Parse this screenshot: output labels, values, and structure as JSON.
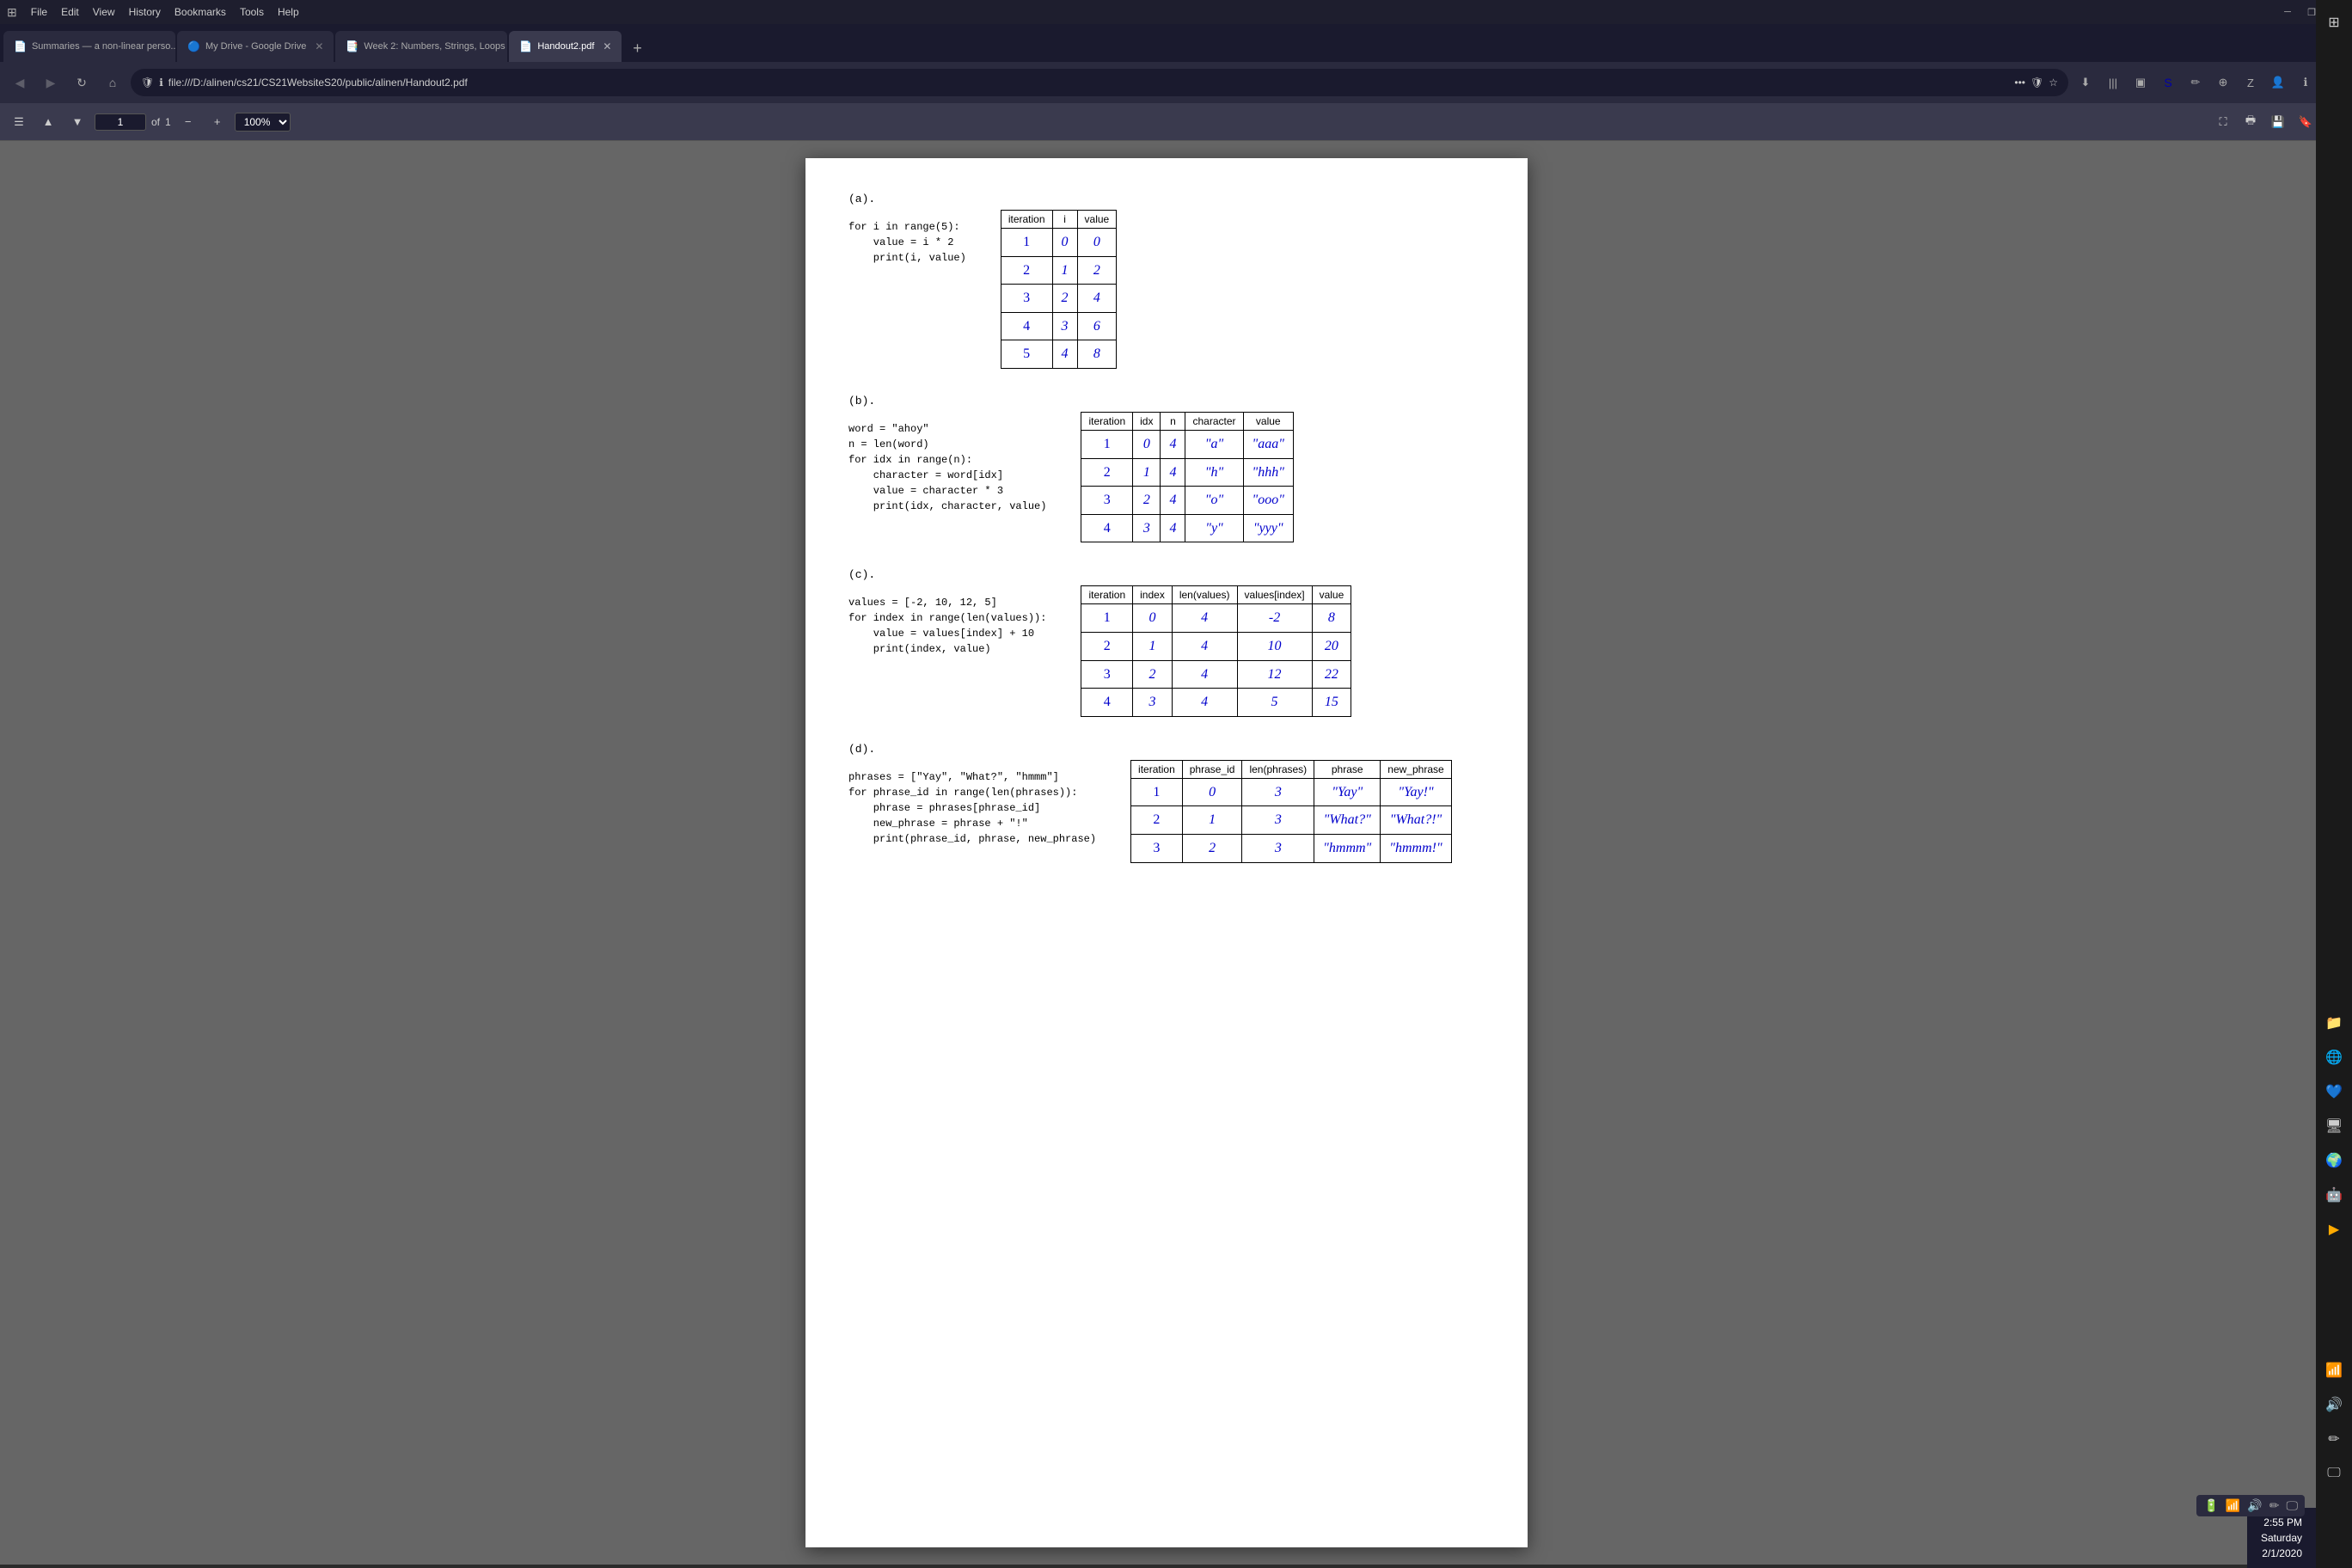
{
  "browser": {
    "title": "Handout2.pdf",
    "tabs": [
      {
        "label": "Summaries — a non-linear perso...",
        "icon": "📄",
        "active": false
      },
      {
        "label": "My Drive - Google Drive",
        "icon": "🔵",
        "active": false
      },
      {
        "label": "Week 2: Numbers, Strings, Loops",
        "icon": "📑",
        "active": false
      },
      {
        "label": "Handout2.pdf",
        "icon": "📄",
        "active": true
      }
    ],
    "address": "file:///D:/alinen/cs21/CS21WebsiteS20/public/alinen/Handout2.pdf",
    "menus": [
      "File",
      "Edit",
      "View",
      "History",
      "Bookmarks",
      "Tools",
      "Help"
    ]
  },
  "pdf_toolbar": {
    "page_current": "1",
    "page_total": "1",
    "zoom": "100%"
  },
  "sections": {
    "a": {
      "label": "(a).",
      "code": [
        "for i in range(5):",
        "    value = i * 2",
        "    print(i, value)"
      ],
      "table": {
        "headers": [
          "iteration",
          "i",
          "value"
        ],
        "rows": [
          [
            "1",
            "0",
            "0"
          ],
          [
            "2",
            "1",
            "2"
          ],
          [
            "3",
            "2",
            "4"
          ],
          [
            "4",
            "3",
            "6"
          ],
          [
            "5",
            "4",
            "8"
          ]
        ]
      }
    },
    "b": {
      "label": "(b).",
      "code": [
        "word = \"ahoy\"",
        "n = len(word)",
        "for idx in range(n):",
        "    character = word[idx]",
        "    value = character * 3",
        "    print(idx, character, value)"
      ],
      "table": {
        "headers": [
          "iteration",
          "idx",
          "n",
          "character",
          "value"
        ],
        "rows": [
          [
            "1",
            "0",
            "4",
            "\"a\"",
            "\"aaa\""
          ],
          [
            "2",
            "1",
            "4",
            "\"h\"",
            "\"hhh\""
          ],
          [
            "3",
            "2",
            "4",
            "\"o\"",
            "\"ooo\""
          ],
          [
            "4",
            "3",
            "4",
            "\"y\"",
            "\"yyy\""
          ]
        ]
      }
    },
    "c": {
      "label": "(c).",
      "code": [
        "values = [-2, 10, 12, 5]",
        "for index in range(len(values)):",
        "    value = values[index] + 10",
        "    print(index, value)"
      ],
      "table": {
        "headers": [
          "iteration",
          "index",
          "len(values)",
          "values[index]",
          "value"
        ],
        "rows": [
          [
            "1",
            "0",
            "4",
            "-2",
            "8"
          ],
          [
            "2",
            "1",
            "4",
            "10",
            "20"
          ],
          [
            "3",
            "2",
            "4",
            "12",
            "22"
          ],
          [
            "4",
            "3",
            "4",
            "5",
            "15"
          ]
        ]
      }
    },
    "d": {
      "label": "(d).",
      "code": [
        "phrases = [\"Yay\", \"What?\", \"hmmm\"]",
        "for phrase_id in range(len(phrases)):",
        "    phrase = phrases[phrase_id]",
        "    new_phrase = phrase + \"!\"",
        "    print(phrase_id, phrase, new_phrase)"
      ],
      "table": {
        "headers": [
          "iteration",
          "phrase_id",
          "len(phrases)",
          "phrase",
          "new_phrase"
        ],
        "rows": [
          [
            "1",
            "0",
            "3",
            "\"Yay\"",
            "\"Yay!\""
          ],
          [
            "2",
            "1",
            "3",
            "\"What?\"",
            "\"What?!\""
          ],
          [
            "3",
            "2",
            "3",
            "\"hmmm\"",
            "\"hmmm!\""
          ]
        ]
      }
    }
  },
  "system": {
    "time": "2:55 PM",
    "date": "Saturday",
    "date_full": "2/1/2020"
  },
  "taskbar": {
    "items": []
  }
}
